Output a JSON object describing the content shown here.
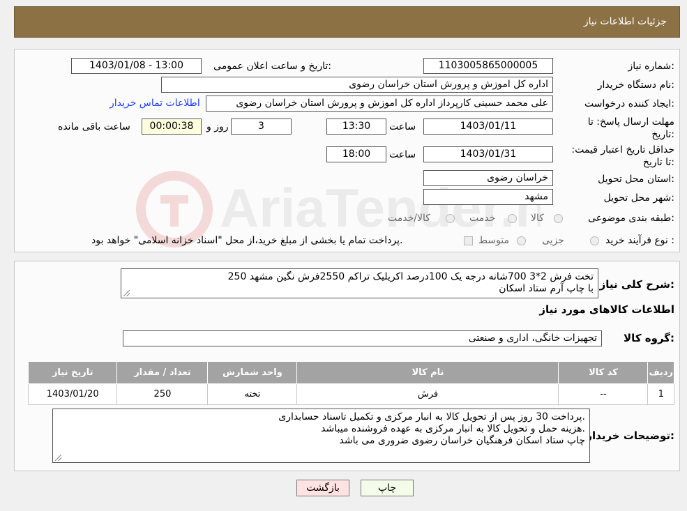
{
  "header": {
    "title": "جزئیات اطلاعات نیاز"
  },
  "form": {
    "need_number_label": "شماره نیاز:",
    "need_number": "1103005865000005",
    "announce_label": "تاریخ و ساعت اعلان عمومی:",
    "announce_value": "1403/01/08 - 13:00",
    "buyer_org_label": "نام دستگاه خریدار:",
    "buyer_org": "اداره کل اموزش و پرورش استان خراسان رضوی",
    "creator_label": "ایجاد کننده درخواست:",
    "creator": "علی محمد حسینی کارپرداز اداره کل اموزش و پرورش استان خراسان رضوی",
    "contact_link": "اطلاعات تماس خریدار",
    "deadline_label": "مهلت ارسال پاسخ: تا تاریخ:",
    "deadline_date": "1403/01/11",
    "time_label": "ساعت",
    "deadline_time": "13:30",
    "days_value": "3",
    "days_label": "روز و",
    "remaining_time": "00:00:38",
    "remaining_label": "ساعت باقی مانده",
    "validity_label": "حداقل تاریخ اعتبار قیمت: تا تاریخ:",
    "validity_date": "1403/01/31",
    "validity_time": "18:00",
    "province_label": "استان محل تحویل:",
    "province": "خراسان رضوی",
    "city_label": "شهر محل تحویل:",
    "city": "مشهد",
    "category_label": "طبقه بندی موضوعی:",
    "category_options": [
      "کالا",
      "خدمت",
      "کالا/خدمت"
    ],
    "process_label": "نوع فرآیند خرید :",
    "process_options": [
      "جزیی",
      "متوسط"
    ],
    "payment_note": "پرداخت تمام یا بخشی از مبلغ خرید،از محل \"اسناد خزانه اسلامی\" خواهد بود."
  },
  "description": {
    "label": "شرح کلی نیاز:",
    "line1": "250 تخت فرش 2*3 700شانه درجه یک 100درصد اکریلیک تراکم 2550فرش نگین مشهد",
    "line2": "با چاپ آرم ستاد اسکان"
  },
  "goods": {
    "section_title": "اطلاعات کالاهای مورد نیاز",
    "group_label": "گروه کالا:",
    "group_value": "تجهیزات خانگی، اداری و صنعتی",
    "columns": [
      "ردیف",
      "کد کالا",
      "نام کالا",
      "واحد شمارش",
      "تعداد / مقدار",
      "تاریخ نیاز"
    ],
    "rows": [
      [
        "1",
        "--",
        "فرش",
        "تخته",
        "250",
        "1403/01/20"
      ]
    ]
  },
  "buyer_notes": {
    "label": "توضیحات خریدار:",
    "line1": "پرداخت 30 روز پس از تحویل کالا به انبار مرکزی و تکمیل تاسناد حسابداری.",
    "line2": "هزینه حمل و تحویل کالا به انبار مرکزی به عهده فروشنده میباشد.",
    "line3": "چاپ ستاد اسکان فرهنگیان خراسان رضوی ضروری می باشد"
  },
  "buttons": {
    "print": "چاپ",
    "back": "بازگشت"
  },
  "watermark": {
    "text": "AriaTender.neT"
  }
}
